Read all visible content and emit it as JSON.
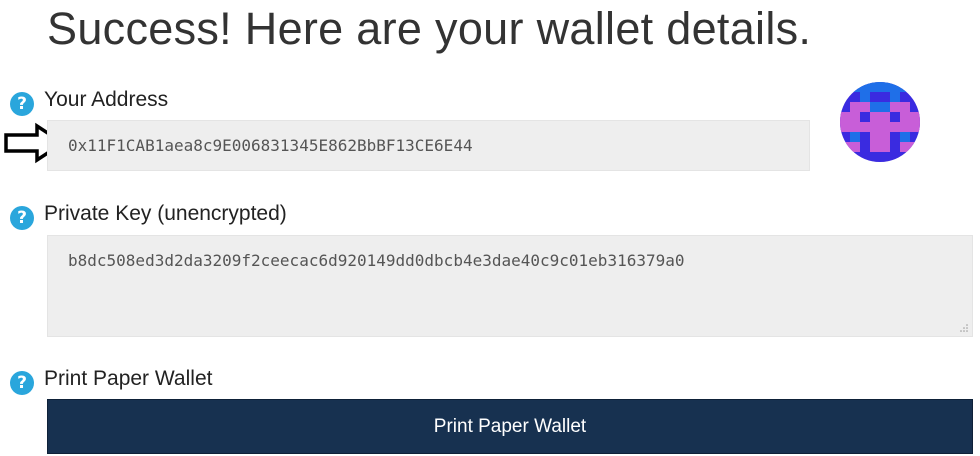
{
  "headline": "Success! Here are your wallet details.",
  "address": {
    "label": "Your Address",
    "help_icon": "question-mark-icon",
    "value": "0x11F1CAB1aea8c9E006831345E862BbBF13CE6E44"
  },
  "private_key": {
    "label": "Private Key (unencrypted)",
    "help_icon": "question-mark-icon",
    "value": "b8dc508ed3d2da3209f2ceecac6d920149dd0dbcb4e3dae40c9c01eb316379a0"
  },
  "paper_wallet": {
    "label": "Print Paper Wallet",
    "help_icon": "question-mark-icon",
    "button_label": "Print Paper Wallet"
  },
  "annotation": {
    "icon": "right-arrow-icon"
  },
  "identicon": {
    "icon": "identicon-avatar",
    "colors": [
      "#3a2be0",
      "#c85ed8",
      "#1f6fe8"
    ]
  },
  "colors": {
    "help_icon": "#2aa6dc",
    "field_bg": "#eeeeee",
    "button_bg": "#173150",
    "button_text": "#ffffff"
  }
}
